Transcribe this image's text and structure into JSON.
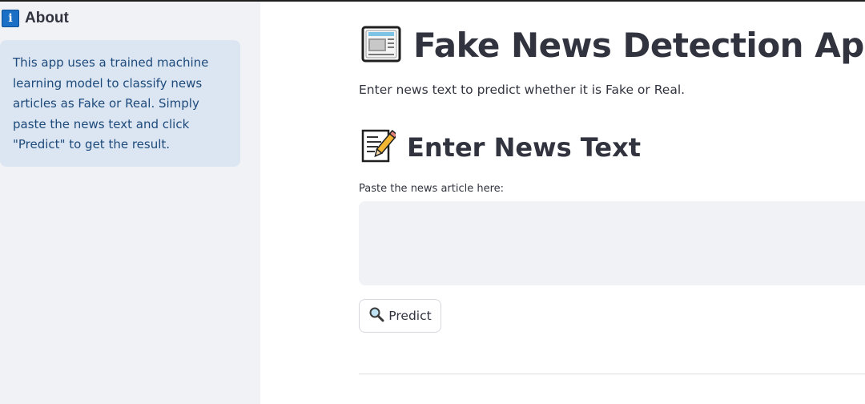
{
  "sidebar": {
    "about_icon": "i",
    "about_title": "About",
    "about_text": "This app uses a trained machine learning model to classify news articles as Fake or Real. Simply paste the news text and click \"Predict\" to get the result."
  },
  "main": {
    "title": "Fake News Detection App",
    "title_icon": "newspaper-icon",
    "subtitle": "Enter news text to predict whether it is Fake or Real.",
    "section_title": "Enter News Text",
    "section_icon": "memo-icon",
    "textarea_label": "Paste the news article here:",
    "textarea_value": "",
    "predict_label": "Predict",
    "predict_icon": "magnifier-icon"
  },
  "colors": {
    "sidebar_bg": "#f0f2f6",
    "info_bg": "#dce6f3",
    "info_text": "#1d4a7a",
    "text": "#31333f"
  }
}
